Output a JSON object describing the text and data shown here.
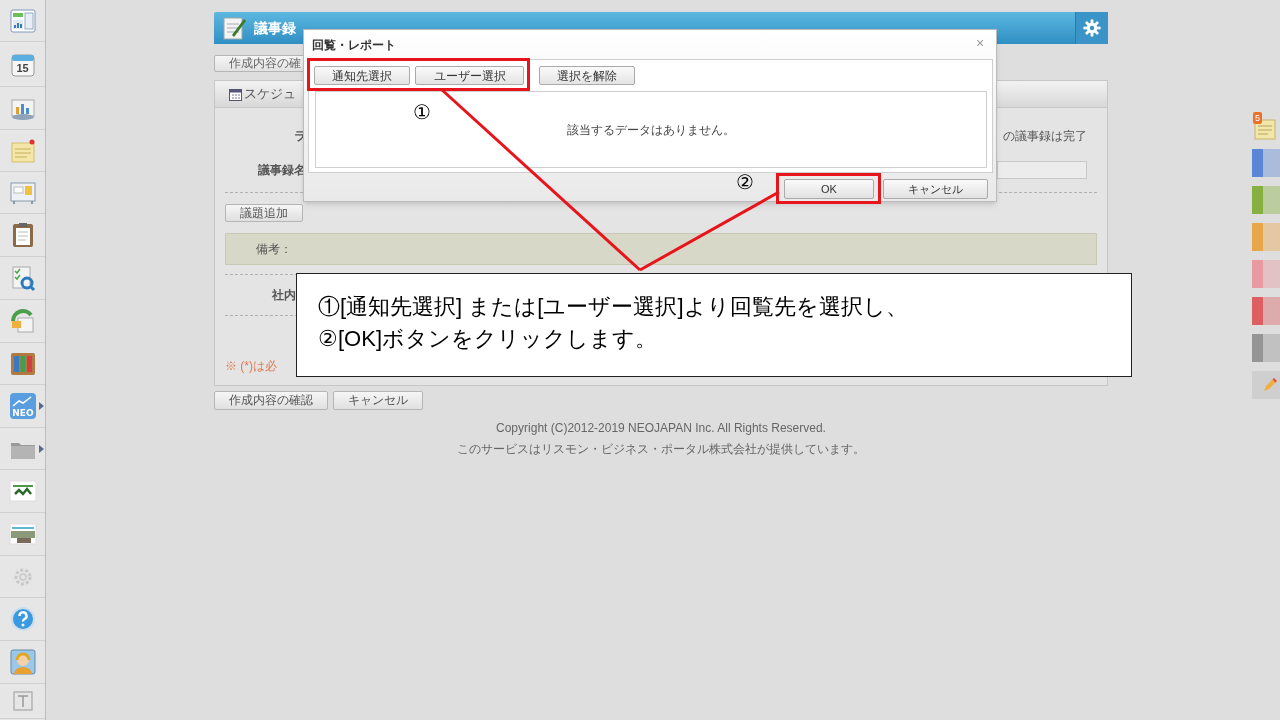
{
  "sidebar": {
    "calendar_day": "15",
    "neo_label": "NEO"
  },
  "header": {
    "module": "議事録"
  },
  "top_button": "作成内容の確",
  "panel": {
    "title": "スケジュ",
    "rows": [
      {
        "label": "ラ",
        "note": "の議事録は完了"
      },
      {
        "label": "議事録名"
      }
    ],
    "add_topic_button": "議題追加",
    "remarks_label": "備考：",
    "internal_label": "社内",
    "required_note": "※ (*)は必"
  },
  "bottom_buttons": [
    "作成内容の確認",
    "キャンセル"
  ],
  "footer": [
    "Copyright (C)2012-2019 NEOJAPAN Inc. All Rights Reserved.",
    "このサービスはリスモン・ビジネス・ポータル株式会社が提供しています。"
  ],
  "right_dock": {
    "badge": "5",
    "tabs": [
      {
        "color": "#5b86d6"
      },
      {
        "color": "#86b040"
      },
      {
        "color": "#e8a64a"
      },
      {
        "color": "#e89aa0"
      },
      {
        "color": "#dd5f62"
      },
      {
        "color": "#959595"
      }
    ]
  },
  "dialog": {
    "title": "回覧・レポート",
    "close": "×",
    "toolbar": [
      "通知先選択",
      "ユーザー選択",
      "選択を解除"
    ],
    "empty_message": "該当するデータはありません。",
    "buttons": [
      "OK",
      "キャンセル"
    ]
  },
  "annotations": {
    "markers": [
      "①",
      "②"
    ],
    "callout": [
      "①[通知先選択] または[ユーザー選択]より回覧先を選択し、",
      "②[OK]ボタンをクリックします。"
    ]
  }
}
